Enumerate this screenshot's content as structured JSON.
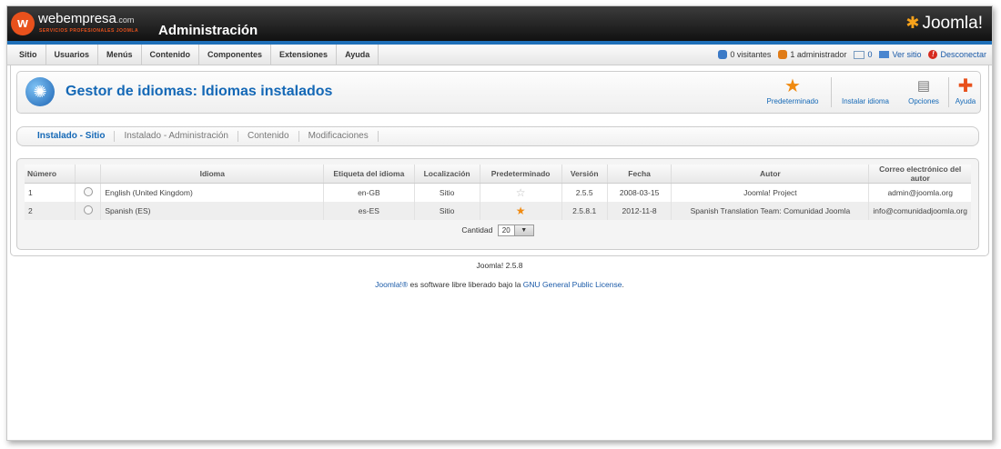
{
  "header": {
    "brand": "webempresa",
    "brand_suffix": ".com",
    "brand_tagline": "SERVICIOS PROFESIONALES JOOMLA",
    "title": "Administración",
    "joomla_logo": "Joomla!"
  },
  "menu": [
    "Sitio",
    "Usuarios",
    "Menús",
    "Contenido",
    "Componentes",
    "Extensiones",
    "Ayuda"
  ],
  "status": {
    "visitors": "0 visitantes",
    "admins": "1 administrador",
    "messages": "0",
    "view_site": "Ver sitio",
    "logout": "Desconectar"
  },
  "toolbar": {
    "page_title": "Gestor de idiomas: Idiomas instalados",
    "default_btn": "Predeterminado",
    "install_btn": "Instalar idioma",
    "options_btn": "Opciones",
    "help_btn": "Ayuda"
  },
  "tabs": [
    "Instalado - Sitio",
    "Instalado - Administración",
    "Contenido",
    "Modificaciones"
  ],
  "table": {
    "headers": [
      "Número",
      "",
      "Idioma",
      "Etiqueta del idioma",
      "Localización",
      "Predeterminado",
      "Versión",
      "Fecha",
      "Autor",
      "Correo electrónico del autor"
    ],
    "rows": [
      {
        "num": "1",
        "language": "English (United Kingdom)",
        "tag": "en-GB",
        "location": "Sitio",
        "default": false,
        "version": "2.5.5",
        "date": "2008-03-15",
        "author": "Joomla! Project",
        "email": "admin@joomla.org"
      },
      {
        "num": "2",
        "language": "Spanish (ES)",
        "tag": "es-ES",
        "location": "Sitio",
        "default": true,
        "version": "2.5.8.1",
        "date": "2012-11-8",
        "author": "Spanish Translation Team: Comunidad Joomla",
        "email": "info@comunidadjoomla.org"
      }
    ]
  },
  "pager": {
    "label": "Cantidad",
    "value": "20"
  },
  "footer": {
    "version": "Joomla! 2.5.8",
    "license_link1": "Joomla!®",
    "license_text": " es software libre liberado bajo la ",
    "license_link2": "GNU General Public License",
    "license_end": "."
  },
  "colors": {
    "accent": "#1468b6",
    "header_stripe": "#1e6fb8",
    "star_active": "#f08a10"
  }
}
